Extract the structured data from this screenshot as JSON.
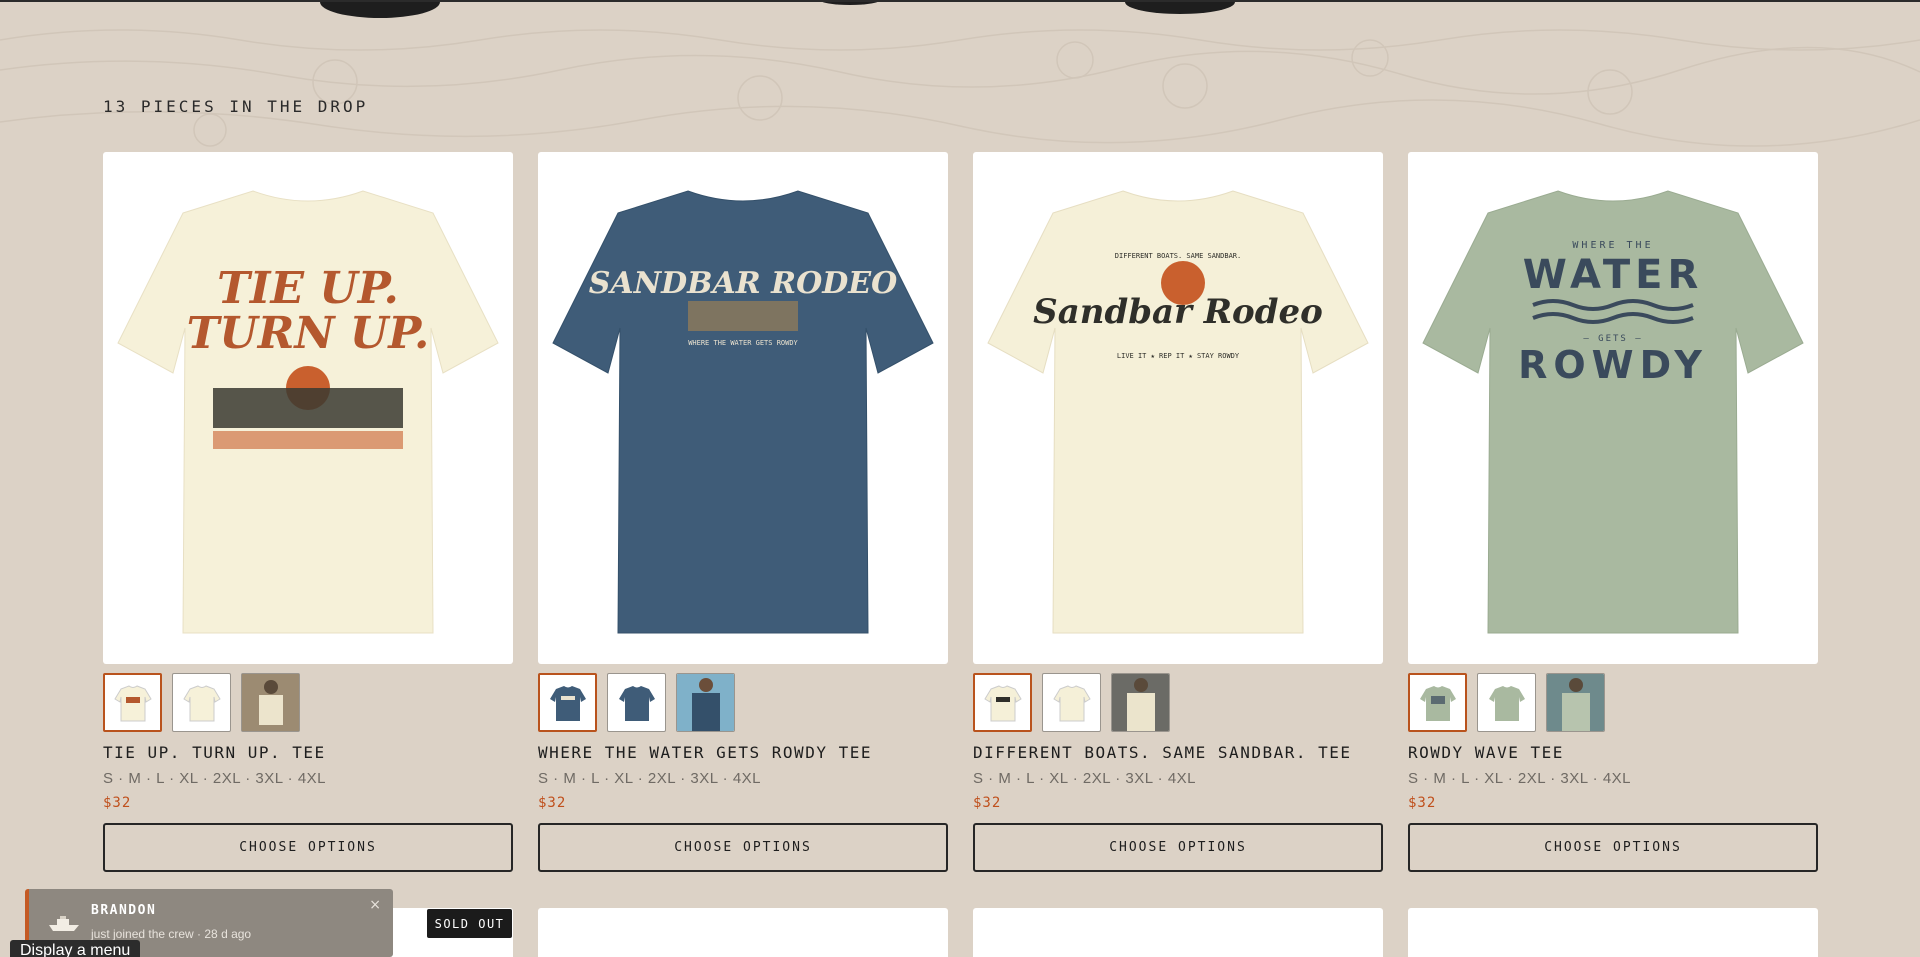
{
  "section": {
    "heading": "13 PIECES IN THE DROP"
  },
  "products": [
    {
      "title": "TIE UP. TURN UP. TEE",
      "sizes": "S · M · L · XL · 2XL · 3XL · 4XL",
      "price": "$32",
      "button": "CHOOSE OPTIONS",
      "shirt_color": "#f6f1d9",
      "print_lines": [
        "TIE UP.",
        "TURN UP."
      ],
      "print_color": "#b4582e"
    },
    {
      "title": "WHERE THE WATER GETS ROWDY TEE",
      "sizes": "S · M · L · XL · 2XL · 3XL · 4XL",
      "price": "$32",
      "button": "CHOOSE OPTIONS",
      "shirt_color": "#3f5c78",
      "print_lines": [
        "SANDBAR RODEO",
        "WHERE THE WATER GETS ROWDY"
      ],
      "print_color": "#eae2cf"
    },
    {
      "title": "DIFFERENT BOATS. SAME SANDBAR. TEE",
      "sizes": "S · M · L · XL · 2XL · 3XL · 4XL",
      "price": "$32",
      "button": "CHOOSE OPTIONS",
      "shirt_color": "#f5f0d8",
      "print_lines": [
        "DIFFERENT BOATS. SAME SANDBAR.",
        "Sandbar Rodeo",
        "LIVE IT ★ REP IT ★ STAY ROWDY"
      ],
      "print_color": "#2f2f2a"
    },
    {
      "title": "ROWDY WAVE TEE",
      "sizes": "S · M · L · XL · 2XL · 3XL · 4XL",
      "price": "$32",
      "button": "CHOOSE OPTIONS",
      "shirt_color": "#a9b9a0",
      "print_lines": [
        "WHERE THE",
        "WATER",
        "— GETS —",
        "ROWDY"
      ],
      "print_color": "#3a4a5c"
    }
  ],
  "badges": {
    "sold_out": "SOLD OUT"
  },
  "toast": {
    "name": "BRANDON",
    "message": "just joined the crew · 28 d ago",
    "close": "×"
  },
  "menu_tooltip": "Display a menu",
  "colors": {
    "accent": "#c0501c",
    "background": "#dcd2c6"
  }
}
